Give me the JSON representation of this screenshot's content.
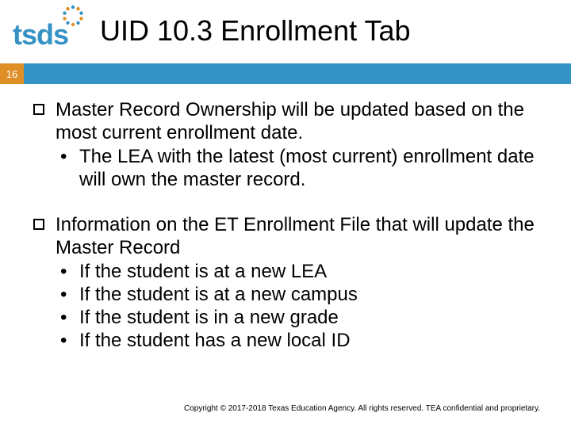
{
  "logo_alt": "tsds",
  "title": "UID 10.3 Enrollment Tab",
  "page_number": "16",
  "bullets": [
    {
      "text": "Master Record Ownership will be updated based on the most current enrollment date.",
      "subs": [
        "The LEA with the latest (most current) enrollment date will own the master record."
      ]
    },
    {
      "text": "Information on the ET Enrollment File that will update the Master Record",
      "subs": [
        "If the student is at a new LEA",
        "If the student is at a new campus",
        "If the student is in a new grade",
        "If the student has a new local ID"
      ]
    }
  ],
  "footer": "Copyright © 2017-2018 Texas Education Agency. All rights reserved. TEA confidential and proprietary."
}
